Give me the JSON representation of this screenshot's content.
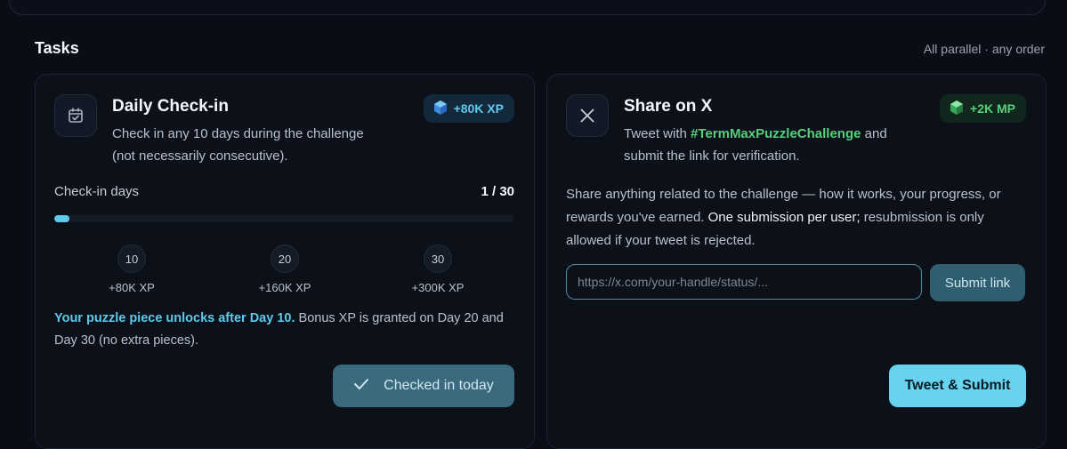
{
  "tasks": {
    "title": "Tasks",
    "hint": "All parallel · any order"
  },
  "daily_checkin": {
    "title": "Daily Check-in",
    "desc_line1": "Check in any 10 days during the challenge",
    "desc_line2": "(not necessarily consecutive).",
    "badge": "+80K XP",
    "progress_label": "Check-in days",
    "progress_value": "1 / 30",
    "progress_fraction": 0.033,
    "milestones": [
      {
        "day": "10",
        "reward": "+80K XP"
      },
      {
        "day": "20",
        "reward": "+160K XP"
      },
      {
        "day": "30",
        "reward": "+300K XP"
      }
    ],
    "note_highlight": "Your puzzle piece unlocks after Day 10.",
    "note_rest": " Bonus XP is granted on Day 20 and Day 30 (no extra pieces).",
    "button_label": "Checked in today",
    "icons": {
      "card": "calendar-check-icon",
      "badge": "xp-gem-icon",
      "button": "checkmark-icon"
    }
  },
  "share_x": {
    "title": "Share on X",
    "desc_prefix": "Tweet with ",
    "hashtag": "#TermMaxPuzzleChallenge",
    "desc_suffix": " and",
    "desc_line2": "submit the link for verification.",
    "badge": "+2K MP",
    "body_text": "Share anything related to the challenge — how it works, your progress, or rewards you've earned. ",
    "body_strong": "One submission per user;",
    "body_text2": " resubmission is only allowed if your tweet is rejected.",
    "input_placeholder": "https://x.com/your-handle/status/...",
    "input_value": "",
    "submit_label": "Submit link",
    "tweet_label": "Tweet & Submit",
    "icons": {
      "card": "x-logo-icon",
      "badge": "mp-gem-icon"
    }
  },
  "colors": {
    "accent_cyan": "#5ec9ec",
    "accent_green": "#55d07a",
    "background": "#0a0d16"
  }
}
